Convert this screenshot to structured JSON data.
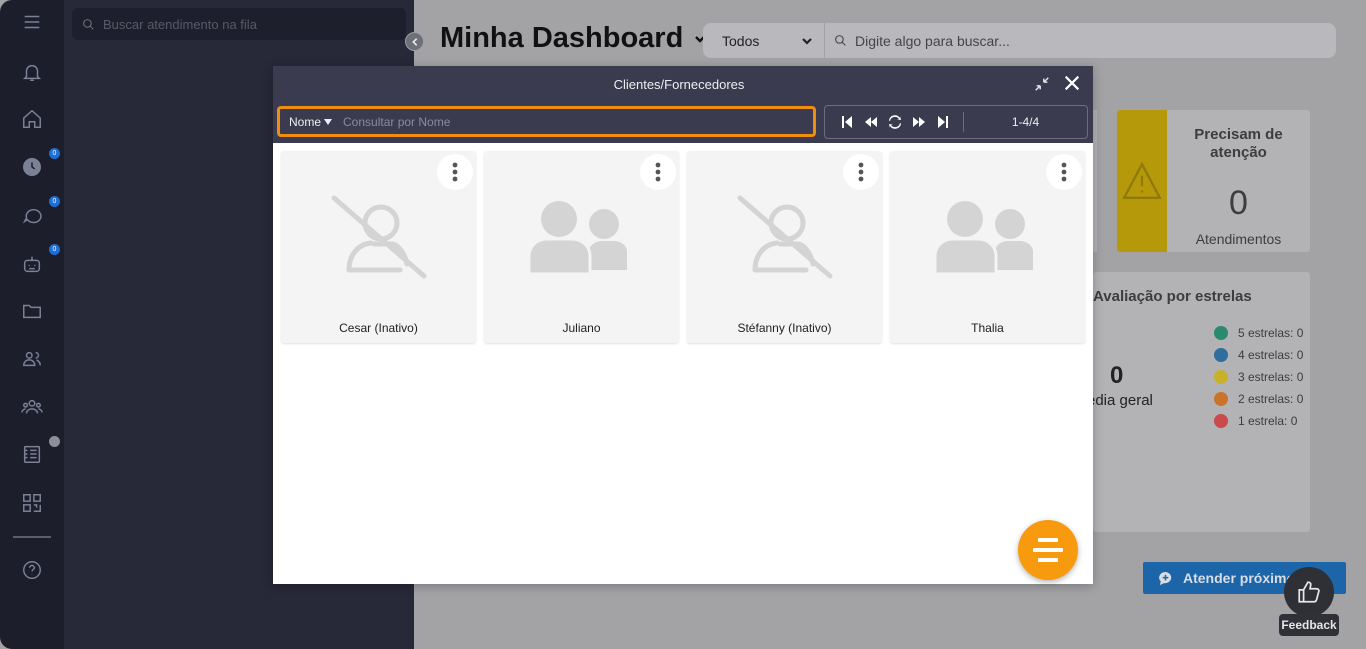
{
  "queue": {
    "search_placeholder": "Buscar atendimento na fila"
  },
  "rail": {
    "badges": [
      "0",
      "0",
      "0"
    ]
  },
  "header": {
    "title": "Minha Dashboard",
    "filter_selected": "Todos",
    "search_placeholder": "Digite algo para buscar..."
  },
  "attention": {
    "title": "Precisam de atenção",
    "count": "0",
    "label": "Atendimentos"
  },
  "rating": {
    "title": "Avaliação por estrelas",
    "average": "0",
    "average_label": "édia geral",
    "legend": [
      {
        "label": "5 estrelas: 0",
        "color": "#2b8a6e"
      },
      {
        "label": "4 estrelas: 0",
        "color": "#2f6d9c"
      },
      {
        "label": "3 estrelas: 0",
        "color": "#c9b02a"
      },
      {
        "label": "2 estrelas: 0",
        "color": "#c9742a"
      },
      {
        "label": "1 estrela: 0",
        "color": "#c94b4b"
      }
    ]
  },
  "attend_button": "Atender próximo",
  "feedback": {
    "label": "Feedback"
  },
  "modal": {
    "title": "Clientes/Fornecedores",
    "filter_field": "Nome",
    "filter_placeholder": "Consultar por Nome",
    "page_count": "1-4/4",
    "cards": [
      {
        "name": "Cesar (Inativo)",
        "image": "no-photo-icon"
      },
      {
        "name": "Juliano",
        "image": "contact-group-icon"
      },
      {
        "name": "Stéfanny (Inativo)",
        "image": "no-photo-icon"
      },
      {
        "name": "Thalia",
        "image": "contact-group-icon"
      }
    ]
  },
  "colors": {
    "accent": "#f08d0f",
    "fab": "#f79a0e",
    "modal_header": "#3a3b4e",
    "attention": "#b6990a",
    "attend": "#1b65a8"
  }
}
